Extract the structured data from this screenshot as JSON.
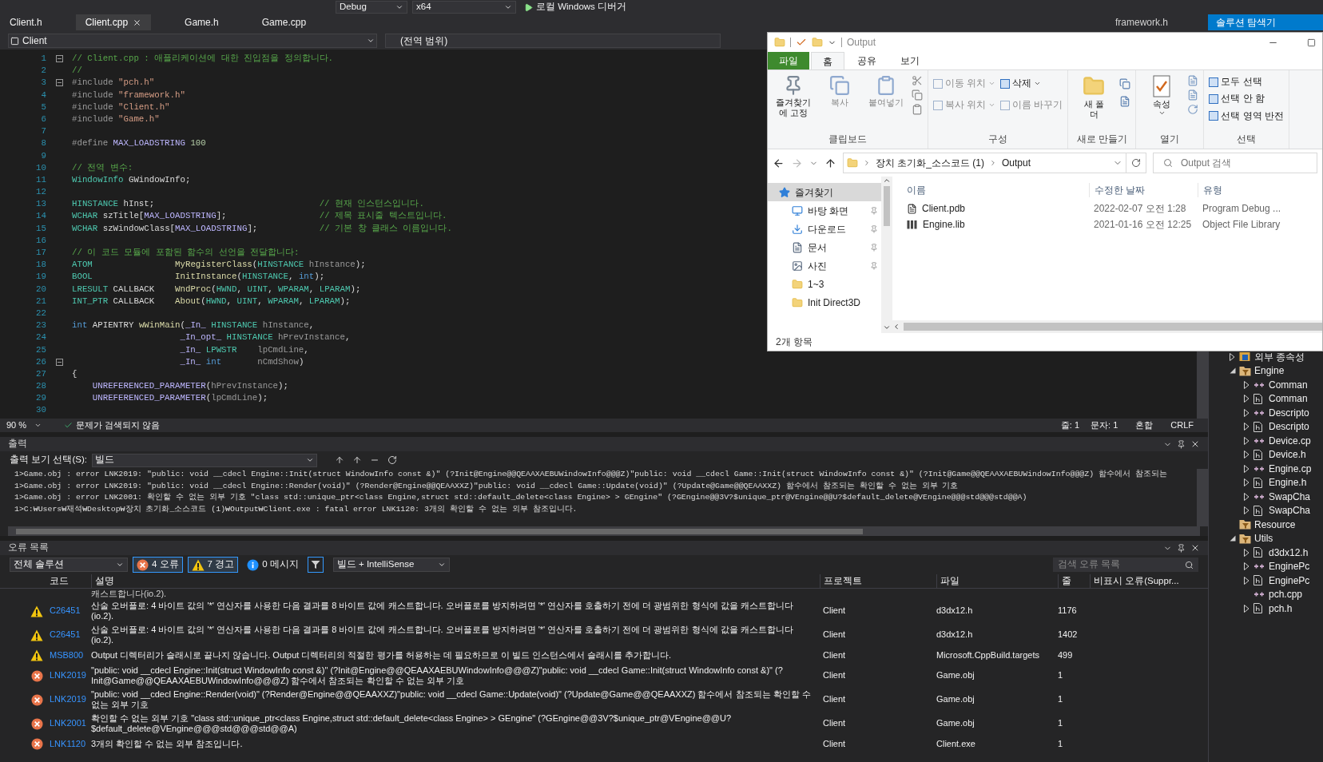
{
  "toolbar": {
    "configuration": "Debug",
    "platform": "x64",
    "debugger": "로컬 Windows 디버거"
  },
  "editor_tabs": [
    {
      "label": "Client.h",
      "selected": false
    },
    {
      "label": "Client.cpp",
      "selected": true
    },
    {
      "label": "Game.h",
      "selected": false
    },
    {
      "label": "Game.cpp",
      "selected": false
    }
  ],
  "side_tabs": [
    {
      "label": "framework.h",
      "selected": false
    },
    {
      "label": "솔루션 탐색기",
      "selected": true
    }
  ],
  "navigation_bar": {
    "project": "Client",
    "scope": "(전역 범위)"
  },
  "code_lines": [
    {
      "number": "1",
      "fold": true,
      "segments": [
        {
          "kind": "comment",
          "text": "// Client.cpp : 애플리케이션에 대한 진입점을 정의합니다."
        }
      ]
    },
    {
      "number": "2",
      "fold": false,
      "segments": [
        {
          "kind": "comment",
          "text": "//"
        }
      ]
    },
    {
      "number": "3",
      "fold": true,
      "segments": [
        {
          "kind": "preproc",
          "text": "#include "
        },
        {
          "kind": "string",
          "text": "\"pch.h\""
        }
      ]
    },
    {
      "number": "4",
      "fold": false,
      "segments": [
        {
          "kind": "preproc",
          "text": "#include "
        },
        {
          "kind": "string",
          "text": "\"framework.h\""
        }
      ]
    },
    {
      "number": "5",
      "fold": false,
      "segments": [
        {
          "kind": "preproc",
          "text": "#include "
        },
        {
          "kind": "string",
          "text": "\"Client.h\""
        }
      ]
    },
    {
      "number": "6",
      "fold": false,
      "segments": [
        {
          "kind": "preproc",
          "text": "#include "
        },
        {
          "kind": "string",
          "text": "\"Game.h\""
        }
      ]
    },
    {
      "number": "7",
      "fold": false
    },
    {
      "number": "8",
      "fold": false,
      "segments": [
        {
          "kind": "preproc",
          "text": "#define "
        },
        {
          "kind": "macro",
          "text": "MAX_LOADSTRING"
        },
        {
          "kind": "number",
          "text": " 100"
        }
      ]
    },
    {
      "number": "9",
      "fold": false
    },
    {
      "number": "10",
      "fold": false,
      "segments": [
        {
          "kind": "comment",
          "text": "// 전역 변수:"
        }
      ]
    },
    {
      "number": "11",
      "fold": false,
      "segments": [
        {
          "kind": "type",
          "text": "WindowInfo"
        },
        {
          "kind": "plain",
          "text": " GWindowInfo;"
        }
      ]
    },
    {
      "number": "12",
      "fold": false
    },
    {
      "number": "13",
      "fold": false,
      "segments": [
        {
          "kind": "type",
          "text": "HINSTANCE"
        },
        {
          "kind": "plain",
          "text": " hInst;                                "
        },
        {
          "kind": "comment",
          "text": "// 현재 인스턴스입니다."
        }
      ]
    },
    {
      "number": "14",
      "fold": false,
      "segments": [
        {
          "kind": "type",
          "text": "WCHAR"
        },
        {
          "kind": "plain",
          "text": " szTitle["
        },
        {
          "kind": "macro",
          "text": "MAX_LOADSTRING"
        },
        {
          "kind": "plain",
          "text": "];                  "
        },
        {
          "kind": "comment",
          "text": "// 제목 표시줄 텍스트입니다."
        }
      ]
    },
    {
      "number": "15",
      "fold": false,
      "segments": [
        {
          "kind": "type",
          "text": "WCHAR"
        },
        {
          "kind": "plain",
          "text": " szWindowClass["
        },
        {
          "kind": "macro",
          "text": "MAX_LOADSTRING"
        },
        {
          "kind": "plain",
          "text": "];            "
        },
        {
          "kind": "comment",
          "text": "// 기본 창 클래스 이름입니다."
        }
      ]
    },
    {
      "number": "16",
      "fold": false
    },
    {
      "number": "17",
      "fold": false,
      "segments": [
        {
          "kind": "comment",
          "text": "// 이 코드 모듈에 포함된 함수의 선언을 전달합니다:"
        }
      ]
    },
    {
      "number": "18",
      "fold": false,
      "segments": [
        {
          "kind": "type",
          "text": "ATOM"
        },
        {
          "kind": "func",
          "text": "                MyRegisterClass"
        },
        {
          "kind": "plain",
          "text": "("
        },
        {
          "kind": "type",
          "text": "HINSTANCE"
        },
        {
          "kind": "param",
          "text": " hInstance"
        },
        {
          "kind": "plain",
          "text": ");"
        }
      ]
    },
    {
      "number": "19",
      "fold": false,
      "segments": [
        {
          "kind": "type",
          "text": "BOOL"
        },
        {
          "kind": "func",
          "text": "                InitInstance"
        },
        {
          "kind": "plain",
          "text": "("
        },
        {
          "kind": "type",
          "text": "HINSTANCE"
        },
        {
          "kind": "plain",
          "text": ", "
        },
        {
          "kind": "keyword",
          "text": "int"
        },
        {
          "kind": "plain",
          "text": ");"
        }
      ]
    },
    {
      "number": "20",
      "fold": false,
      "segments": [
        {
          "kind": "type",
          "text": "LRESULT"
        },
        {
          "kind": "plain",
          "text": " CALLBACK"
        },
        {
          "kind": "func",
          "text": "    WndProc"
        },
        {
          "kind": "plain",
          "text": "("
        },
        {
          "kind": "type",
          "text": "HWND"
        },
        {
          "kind": "plain",
          "text": ", "
        },
        {
          "kind": "type",
          "text": "UINT"
        },
        {
          "kind": "plain",
          "text": ", "
        },
        {
          "kind": "type",
          "text": "WPARAM"
        },
        {
          "kind": "plain",
          "text": ", "
        },
        {
          "kind": "type",
          "text": "LPARAM"
        },
        {
          "kind": "plain",
          "text": ");"
        }
      ]
    },
    {
      "number": "21",
      "fold": false,
      "segments": [
        {
          "kind": "type",
          "text": "INT_PTR"
        },
        {
          "kind": "plain",
          "text": " CALLBACK"
        },
        {
          "kind": "func",
          "text": "    About"
        },
        {
          "kind": "plain",
          "text": "("
        },
        {
          "kind": "type",
          "text": "HWND"
        },
        {
          "kind": "plain",
          "text": ", "
        },
        {
          "kind": "type",
          "text": "UINT"
        },
        {
          "kind": "plain",
          "text": ", "
        },
        {
          "kind": "type",
          "text": "WPARAM"
        },
        {
          "kind": "plain",
          "text": ", "
        },
        {
          "kind": "type",
          "text": "LPARAM"
        },
        {
          "kind": "plain",
          "text": ");"
        }
      ]
    },
    {
      "number": "22",
      "fold": false
    },
    {
      "number": "23",
      "fold": false,
      "segments": [
        {
          "kind": "keyword",
          "text": "int"
        },
        {
          "kind": "plain",
          "text": " APIENTRY "
        },
        {
          "kind": "func",
          "text": "wWinMain"
        },
        {
          "kind": "plain",
          "text": "("
        },
        {
          "kind": "macro",
          "text": "_In_"
        },
        {
          "kind": "type",
          "text": " HINSTANCE"
        },
        {
          "kind": "param",
          "text": " hInstance"
        },
        {
          "kind": "plain",
          "text": ","
        }
      ]
    },
    {
      "number": "24",
      "fold": false,
      "segments": [
        {
          "kind": "macro",
          "text": "                     _In_opt_"
        },
        {
          "kind": "type",
          "text": " HINSTANCE"
        },
        {
          "kind": "param",
          "text": " hPrevInstance"
        },
        {
          "kind": "plain",
          "text": ","
        }
      ]
    },
    {
      "number": "25",
      "fold": false,
      "segments": [
        {
          "kind": "macro",
          "text": "                     _In_"
        },
        {
          "kind": "type",
          "text": " LPWSTR"
        },
        {
          "kind": "param",
          "text": "    lpCmdLine"
        },
        {
          "kind": "plain",
          "text": ","
        }
      ]
    },
    {
      "number": "26",
      "fold": true,
      "segments": [
        {
          "kind": "macro",
          "text": "                     _In_"
        },
        {
          "kind": "keyword",
          "text": " int"
        },
        {
          "kind": "param",
          "text": "       nCmdShow"
        },
        {
          "kind": "plain",
          "text": ")"
        }
      ]
    },
    {
      "number": "27",
      "fold": false,
      "segments": [
        {
          "kind": "plain",
          "text": "{"
        }
      ]
    },
    {
      "number": "28",
      "fold": false,
      "segments": [
        {
          "kind": "macro",
          "text": "    UNREFERENCED_PARAMETER"
        },
        {
          "kind": "plain",
          "text": "("
        },
        {
          "kind": "param",
          "text": "hPrevInstance"
        },
        {
          "kind": "plain",
          "text": ");"
        }
      ]
    },
    {
      "number": "29",
      "fold": false,
      "segments": [
        {
          "kind": "macro",
          "text": "    UNREFERENCED_PARAMETER"
        },
        {
          "kind": "plain",
          "text": "("
        },
        {
          "kind": "param",
          "text": "lpCmdLine"
        },
        {
          "kind": "plain",
          "text": ");"
        }
      ]
    },
    {
      "number": "30",
      "fold": false
    }
  ],
  "editor_status": {
    "zoom": "90 %",
    "issues": "문제가 검색되지 않음",
    "line": "줄: 1",
    "column": "문자: 1",
    "indent": "혼합",
    "line_ending": "CRLF"
  },
  "output_panel": {
    "title": "출력",
    "source_label": "출력 보기 선택(S):",
    "source": "빌드",
    "lines": [
      "1>Game.obj : error LNK2019: \"public: void __cdecl Engine::Init(struct WindowInfo const &)\" (?Init@Engine@@QEAAXAEBUWindowInfo@@@Z)\"public: void __cdecl Game::Init(struct WindowInfo const &)\" (?Init@Game@@QEAAXAEBUWindowInfo@@@Z) 함수에서 참조되는",
      "1>Game.obj : error LNK2019: \"public: void __cdecl Engine::Render(void)\" (?Render@Engine@@QEAAXXZ)\"public: void __cdecl Game::Update(void)\" (?Update@Game@@QEAAXXZ) 함수에서 참조되는 확인할 수 없는 외부 기호",
      "1>Game.obj : error LNK2001: 확인할 수 없는 외부 기호 \"class std::unique_ptr<class Engine,struct std::default_delete<class Engine> > GEngine\" (?GEngine@@3V?$unique_ptr@VEngine@@U?$default_delete@VEngine@@@std@@@std@@A)",
      "1>C:₩Users₩재석₩Desktop₩장치 초기화_소스코드 (1)₩Output₩Client.exe : fatal error LNK1120: 3개의 확인할 수 없는 외부 참조입니다."
    ]
  },
  "error_list": {
    "title": "오류 목록",
    "scope": "전체 솔루션",
    "filters": [
      {
        "kind": "error",
        "label": "4 오류",
        "selected": true
      },
      {
        "kind": "warning",
        "label": "7 경고",
        "selected": true
      },
      {
        "kind": "message",
        "label": "0 메시지",
        "selected": false
      }
    ],
    "build_filter": "빌드 + IntelliSense",
    "search_placeholder": "검색 오류 목록",
    "columns": [
      "코드",
      "설명",
      "프로젝트",
      "파일",
      "줄",
      "비표시 오류(Suppr..."
    ],
    "rows": [
      {
        "kind": "partial",
        "description": "캐스트합니다(io.2)."
      },
      {
        "kind": "warning",
        "code": "C26451",
        "description": "산술 오버플로: 4 바이트 값의 '*' 연산자를 사용한 다음 결과를 8 바이트 값에 캐스트합니다. 오버플로를 방지하려면 '*' 연산자를 호출하기 전에 더 광범위한 형식에 값을 캐스트합니다(io.2).",
        "project": "Client",
        "file": "d3dx12.h",
        "line": "1176"
      },
      {
        "kind": "warning",
        "code": "C26451",
        "description": "산술 오버플로: 4 바이트 값의 '*' 연산자를 사용한 다음 결과를 8 바이트 값에 캐스트합니다. 오버플로를 방지하려면 '*' 연산자를 호출하기 전에 더 광범위한 형식에 값을 캐스트합니다(io.2).",
        "project": "Client",
        "file": "d3dx12.h",
        "line": "1402"
      },
      {
        "kind": "warning",
        "code": "MSB800",
        "description": "Output 디렉터리가 슬래시로 끝나지 않습니다. Output 디렉터리의 적절한 평가를 허용하는 데 필요하므로 이 빌드 인스턴스에서 슬래시를 추가합니다.",
        "project": "Client",
        "file": "Microsoft.CppBuild.targets",
        "line": "499"
      },
      {
        "kind": "error",
        "code": "LNK2019",
        "description": "\"public: void __cdecl Engine::Init(struct WindowInfo const &)\" (?Init@Engine@@QEAAXAEBUWindowInfo@@@Z)\"public: void __cdecl Game::Init(struct WindowInfo const &)\" (?Init@Game@@QEAAXAEBUWindowInfo@@@Z) 함수에서 참조되는 확인할 수 없는 외부 기호",
        "project": "Client",
        "file": "Game.obj",
        "line": "1"
      },
      {
        "kind": "error",
        "code": "LNK2019",
        "description": "\"public: void __cdecl Engine::Render(void)\" (?Render@Engine@@QEAAXXZ)\"public: void __cdecl Game::Update(void)\" (?Update@Game@@QEAAXXZ) 함수에서 참조되는 확인할 수 없는 외부 기호",
        "project": "Client",
        "file": "Game.obj",
        "line": "1"
      },
      {
        "kind": "error",
        "code": "LNK2001",
        "description": "확인할 수 없는 외부 기호 \"class std::unique_ptr<class Engine,struct std::default_delete<class Engine> > GEngine\" (?GEngine@@3V?$unique_ptr@VEngine@@U?$default_delete@VEngine@@@std@@@std@@A)",
        "project": "Client",
        "file": "Game.obj",
        "line": "1"
      },
      {
        "kind": "error",
        "code": "LNK1120",
        "description": "3개의 확인할 수 없는 외부 참조입니다.",
        "project": "Client",
        "file": "Client.exe",
        "line": "1"
      }
    ]
  },
  "solution_tree": [
    {
      "label": "외부 종속성",
      "kind": "references",
      "expanded": false
    },
    {
      "label": "Engine",
      "kind": "filter",
      "expanded": true,
      "children": [
        {
          "label": "Comman",
          "kind": "cpp",
          "expanded": false
        },
        {
          "label": "Comman",
          "kind": "h",
          "expanded": false
        },
        {
          "label": "Descripto",
          "kind": "cpp",
          "expanded": false
        },
        {
          "label": "Descripto",
          "kind": "h",
          "expanded": false
        },
        {
          "label": "Device.cp",
          "kind": "cpp",
          "expanded": false
        },
        {
          "label": "Device.h",
          "kind": "h",
          "expanded": false
        },
        {
          "label": "Engine.cp",
          "kind": "cpp",
          "expanded": false
        },
        {
          "label": "Engine.h",
          "kind": "h",
          "expanded": false
        },
        {
          "label": "SwapCha",
          "kind": "cpp",
          "expanded": false
        },
        {
          "label": "SwapCha",
          "kind": "h",
          "expanded": false
        }
      ]
    },
    {
      "label": "Resource",
      "kind": "filter"
    },
    {
      "label": "Utils",
      "kind": "filter",
      "expanded": true,
      "children": [
        {
          "label": "d3dx12.h",
          "kind": "h",
          "expanded": false
        },
        {
          "label": "EnginePc",
          "kind": "cpp",
          "expanded": false
        },
        {
          "label": "EnginePc",
          "kind": "h",
          "expanded": false
        },
        {
          "label": "pch.cpp",
          "kind": "cpp"
        },
        {
          "label": "pch.h",
          "kind": "h",
          "expanded": false
        }
      ]
    }
  ],
  "explorer": {
    "title": "Output",
    "ribbon_tabs": [
      {
        "label": "파일",
        "kind": "file",
        "selected": false
      },
      {
        "label": "홈",
        "kind": "tab",
        "selected": true
      },
      {
        "label": "공유",
        "kind": "tab",
        "selected": false
      },
      {
        "label": "보기",
        "kind": "tab",
        "selected": false
      }
    ],
    "ribbon_groups": [
      {
        "label": "클립보드",
        "buttons": [
          {
            "label": "즐겨찾기에 고정",
            "kind": "large",
            "disabled": false,
            "dropdown": false
          },
          {
            "label": "복사",
            "kind": "large",
            "disabled": true,
            "dropdown": false
          },
          {
            "label": "붙여넣기",
            "kind": "large",
            "disabled": true,
            "dropdown": false
          }
        ]
      },
      {
        "label": "구성",
        "buttons": [
          {
            "label": "이동 위치",
            "kind": "small",
            "disabled": true,
            "dropdown": true
          },
          {
            "label": "복사 위치",
            "kind": "small",
            "disabled": true,
            "dropdown": true
          },
          {
            "label": "삭제",
            "kind": "small",
            "disabled": false,
            "dropdown": true
          },
          {
            "label": "이름 바꾸기",
            "kind": "small",
            "disabled": true,
            "dropdown": false
          }
        ]
      },
      {
        "label": "새로 만들기",
        "buttons": [
          {
            "label": "새 폴더",
            "kind": "large",
            "disabled": false,
            "dropdown": false
          }
        ]
      },
      {
        "label": "열기",
        "buttons": [
          {
            "label": "속성",
            "kind": "large",
            "disabled": false,
            "dropdown": true
          }
        ]
      },
      {
        "label": "선택",
        "buttons": [
          {
            "label": "모두 선택",
            "kind": "small",
            "disabled": false,
            "dropdown": false
          },
          {
            "label": "선택 안 함",
            "kind": "small",
            "disabled": false,
            "dropdown": false
          },
          {
            "label": "선택 영역 반전",
            "kind": "small",
            "disabled": false,
            "dropdown": false
          }
        ]
      }
    ],
    "breadcrumbs": [
      "장치 초기화_소스코드 (1)",
      "Output"
    ],
    "search_placeholder": "Output 검색",
    "nav_items": [
      {
        "label": "즐겨찾기",
        "kind": "favorites",
        "pinned": false,
        "selected": true
      },
      {
        "label": "바탕 화면",
        "kind": "desktop",
        "pinned": true,
        "selected": false
      },
      {
        "label": "다운로드",
        "kind": "downloads",
        "pinned": true,
        "selected": false
      },
      {
        "label": "문서",
        "kind": "documents",
        "pinned": true,
        "selected": false
      },
      {
        "label": "사진",
        "kind": "pictures",
        "pinned": true,
        "selected": false
      },
      {
        "label": "1~3",
        "kind": "folder",
        "pinned": false,
        "selected": false
      },
      {
        "label": "Init Direct3D",
        "kind": "folder",
        "pinned": false,
        "selected": false
      }
    ],
    "columns": [
      "이름",
      "수정한 날짜",
      "유형"
    ],
    "files": [
      {
        "name": "Client.pdb",
        "modified": "2022-02-07 오전 1:28",
        "type": "Program Debug ...",
        "kind": "pdb"
      },
      {
        "name": "Engine.lib",
        "modified": "2021-01-16 오전 12:25",
        "type": "Object File Library",
        "kind": "lib"
      }
    ],
    "status": "2개 항목"
  }
}
